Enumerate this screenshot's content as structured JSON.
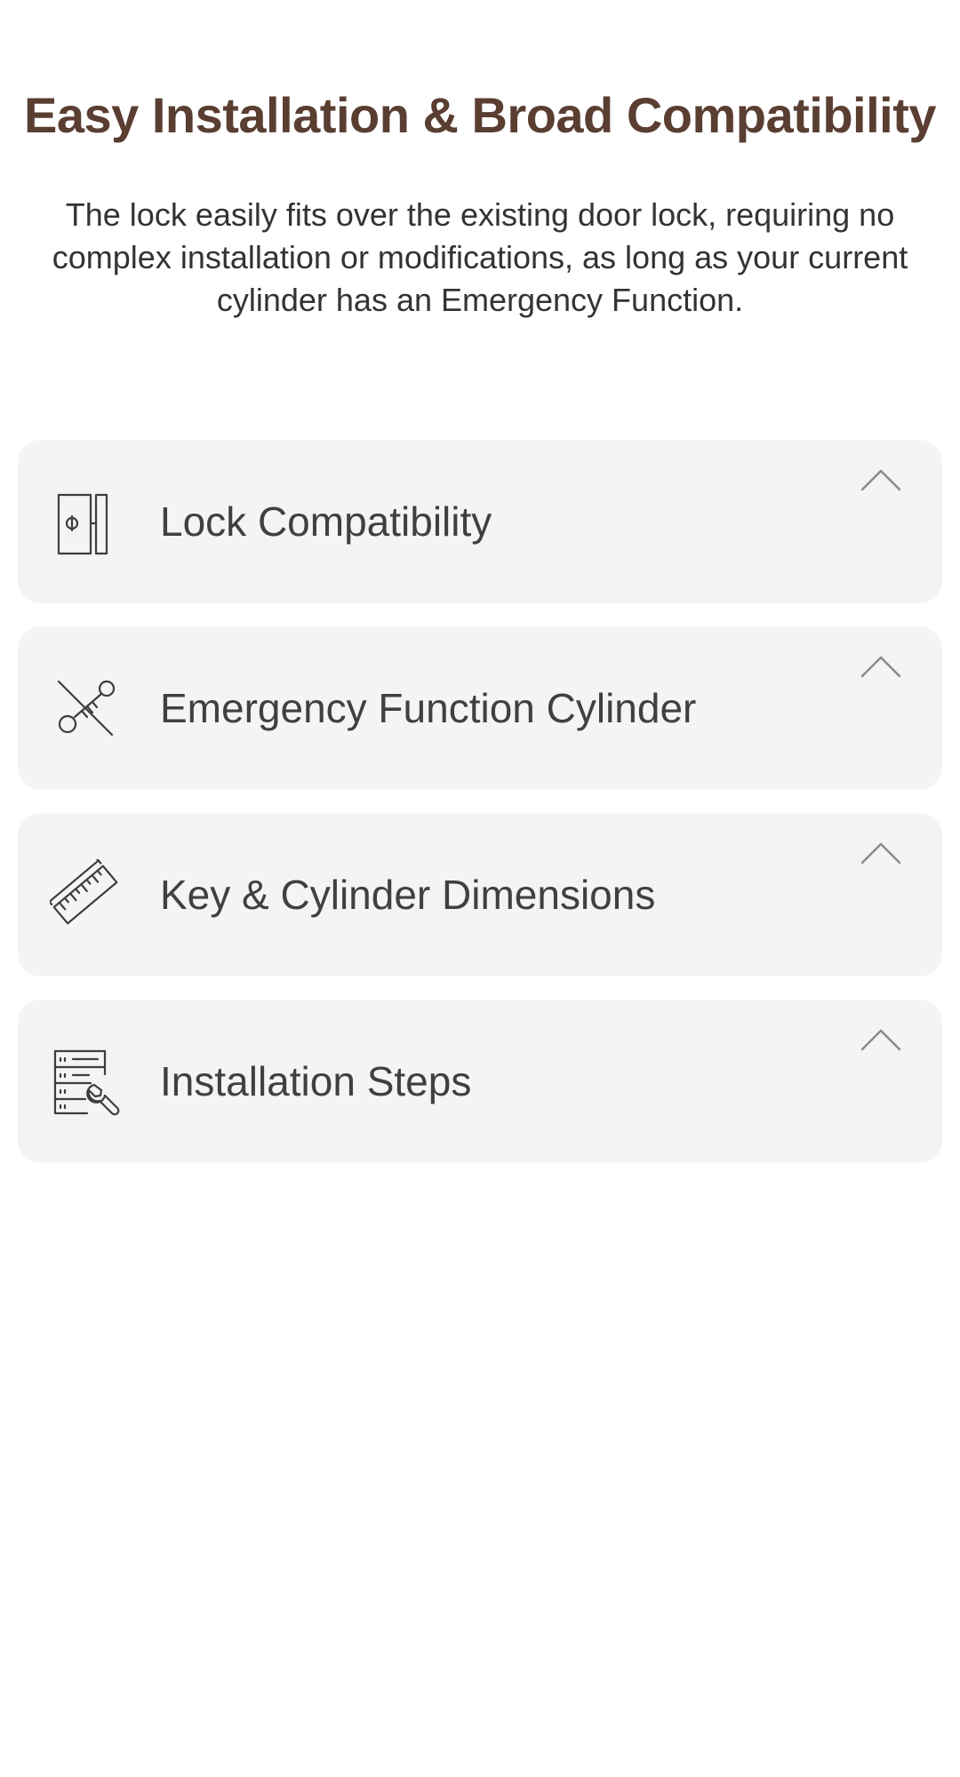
{
  "header": {
    "title": "Easy Installation & Broad Compatibility",
    "description": "The lock easily fits over the existing door lock, requiring no complex installation or modifications, as long as your current cylinder has an Emergency Function."
  },
  "colors": {
    "title": "#5a3e32",
    "card_background": "#f4f4f4",
    "label_text": "#404040",
    "chevron": "#8a8a8a"
  },
  "accordion": {
    "items": [
      {
        "label": "Lock Compatibility",
        "icon": "door-lock-icon",
        "state": "collapsed"
      },
      {
        "label": "Emergency Function Cylinder",
        "icon": "key-crossed-icon",
        "state": "collapsed"
      },
      {
        "label": "Key & Cylinder Dimensions",
        "icon": "ruler-icon",
        "state": "collapsed"
      },
      {
        "label": "Installation Steps",
        "icon": "checklist-wrench-icon",
        "state": "collapsed"
      }
    ]
  }
}
